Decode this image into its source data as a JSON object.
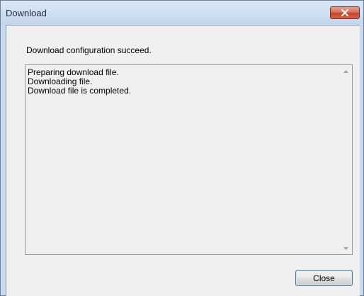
{
  "window": {
    "title": "Download"
  },
  "dialog": {
    "message": "Download configuration succeed.",
    "log_lines": [
      "Preparing download file.",
      "Downloading file.",
      "Download file is completed."
    ],
    "close_button_label": "Close"
  },
  "icons": {
    "title_close": "close-icon",
    "scroll_up": "arrow-up-icon",
    "scroll_down": "arrow-down-icon"
  },
  "colors": {
    "title_close_button": "#c9452e",
    "button_focus_border": "#3c7fb1"
  }
}
